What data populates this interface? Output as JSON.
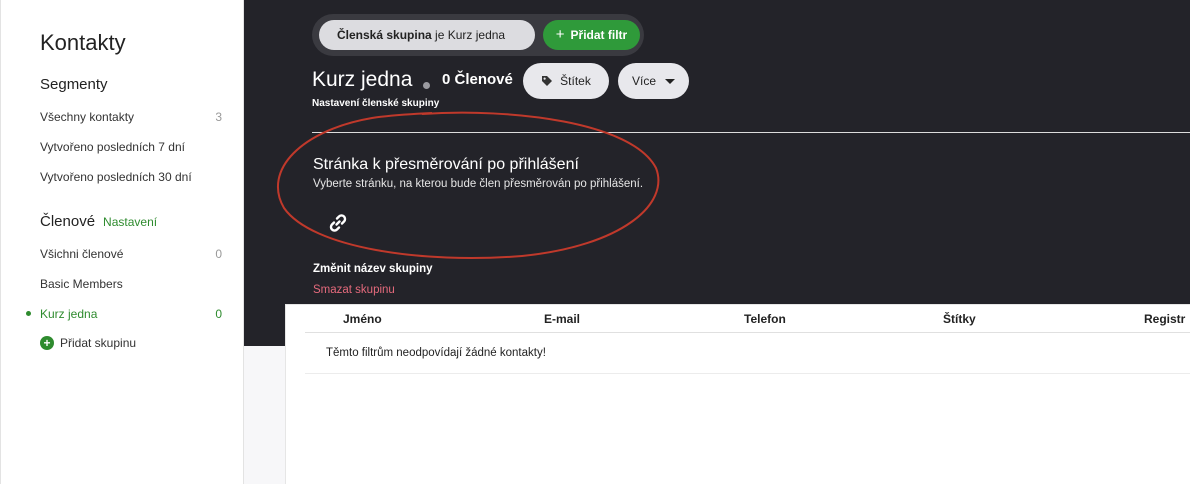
{
  "sidebar": {
    "title": "Kontakty",
    "segments_heading": "Segmenty",
    "segments": [
      {
        "label": "Všechny kontakty",
        "count": "3"
      },
      {
        "label": "Vytvořeno posledních 7 dní",
        "count": ""
      },
      {
        "label": "Vytvořeno posledních 30 dní",
        "count": ""
      }
    ],
    "members_heading": "Členové",
    "members_settings": "Nastavení",
    "groups": [
      {
        "label": "Všichni členové",
        "count": "0"
      },
      {
        "label": "Basic Members",
        "count": ""
      },
      {
        "label": "Kurz jedna",
        "count": "0",
        "active": true
      }
    ],
    "add_group": "Přidat skupinu"
  },
  "filter": {
    "field": "Členská skupina",
    "operator_value": " je Kurz jedna",
    "add_filter": "Přidat filtr"
  },
  "header": {
    "group_name": "Kurz jedna",
    "members_count": "0 Členové",
    "tag_button": "Štítek",
    "more_button": "Více",
    "group_settings": "Nastavení členské skupiny"
  },
  "redirect": {
    "title": "Stránka k přesměrování po přihlášení",
    "description": "Vyberte stránku, na kterou bude člen přesměrován po přihlášení."
  },
  "actions": {
    "rename": "Změnit název skupiny",
    "delete": "Smazat skupinu"
  },
  "table": {
    "columns": [
      "Jméno",
      "E-mail",
      "Telefon",
      "Štítky",
      "Registr"
    ],
    "empty_message": "Těmto filtrům neodpovídají žádné kontakty!"
  },
  "colors": {
    "accent_green": "#2e8b2e",
    "dark_bg": "#232329",
    "danger_pink": "#e46a7c",
    "annotation_red": "#c0392b"
  },
  "icons": {
    "tag": "tag-icon",
    "link": "link-icon",
    "plus": "plus-icon",
    "caret": "chevron-down-icon"
  }
}
